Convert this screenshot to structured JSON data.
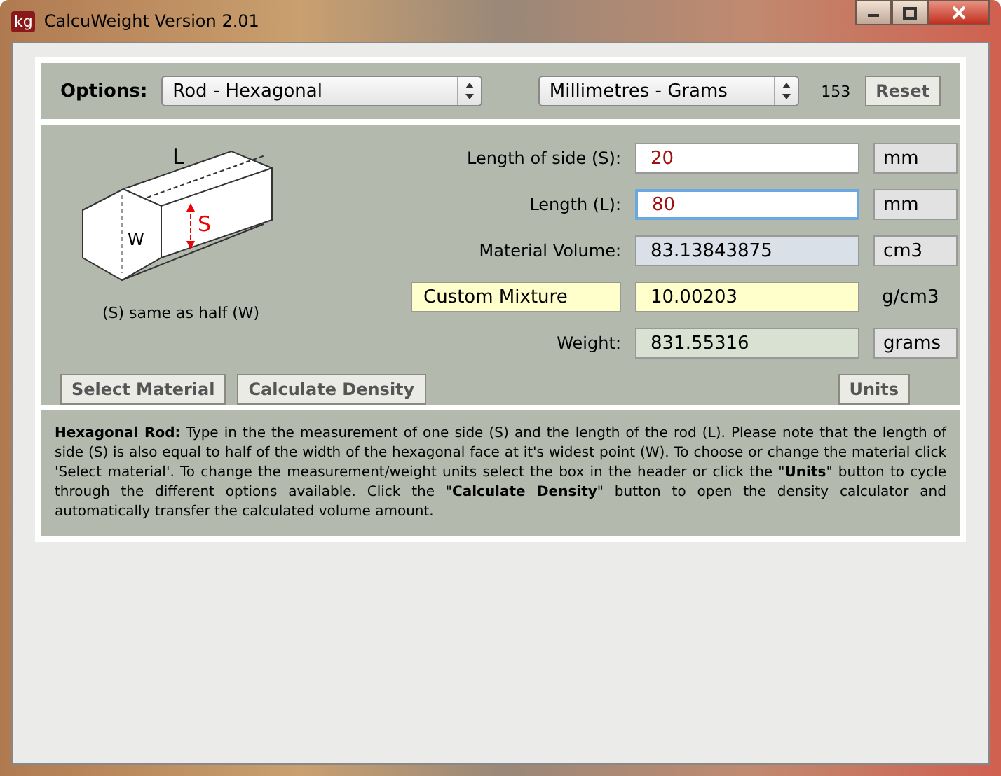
{
  "window": {
    "icon_text": "kg",
    "title": "CalcuWeight Version 2.01"
  },
  "options": {
    "label": "Options:",
    "shape": "Rod - Hexagonal",
    "units": "Millimetres - Grams",
    "count": "153",
    "reset": "Reset"
  },
  "diagram": {
    "length_label": "L",
    "side_label": "S",
    "width_label": "W",
    "caption": "(S) same as half (W)"
  },
  "fields": [
    {
      "kind": "input",
      "label": "Length of side (S):",
      "value": "20",
      "unit": "mm",
      "unit_boxed": true,
      "focused": false
    },
    {
      "kind": "input",
      "label": "Length (L):",
      "value": "80",
      "unit": "mm",
      "unit_boxed": true,
      "focused": true
    },
    {
      "kind": "volume",
      "label": "Material Volume:",
      "value": "83.13843875",
      "unit": "cm3",
      "unit_boxed": true,
      "focused": false
    },
    {
      "kind": "density",
      "label": "Custom Mixture",
      "value": "10.00203",
      "unit": "g/cm3",
      "unit_boxed": false,
      "focused": false
    },
    {
      "kind": "weight",
      "label": "Weight:",
      "value": "831.55316",
      "unit": "grams",
      "unit_boxed": true,
      "focused": false
    }
  ],
  "buttons": {
    "select": "Select Material",
    "density": "Calculate Density",
    "units": "Units"
  },
  "help": "**Hexagonal Rod:** Type in the the measurement of one side (S) and the length of the rod (L). Please note that the length of side (S) is also equal to half of the width of the hexagonal face at it's widest point (W). To choose or change the material click 'Select material'. To change the measurement/weight units select the box in the header or click the \"**Units**\" button to cycle through the different options available. Click the \"**Calculate Density**\" button to open the density calculator and automatically transfer the calculated volume amount."
}
